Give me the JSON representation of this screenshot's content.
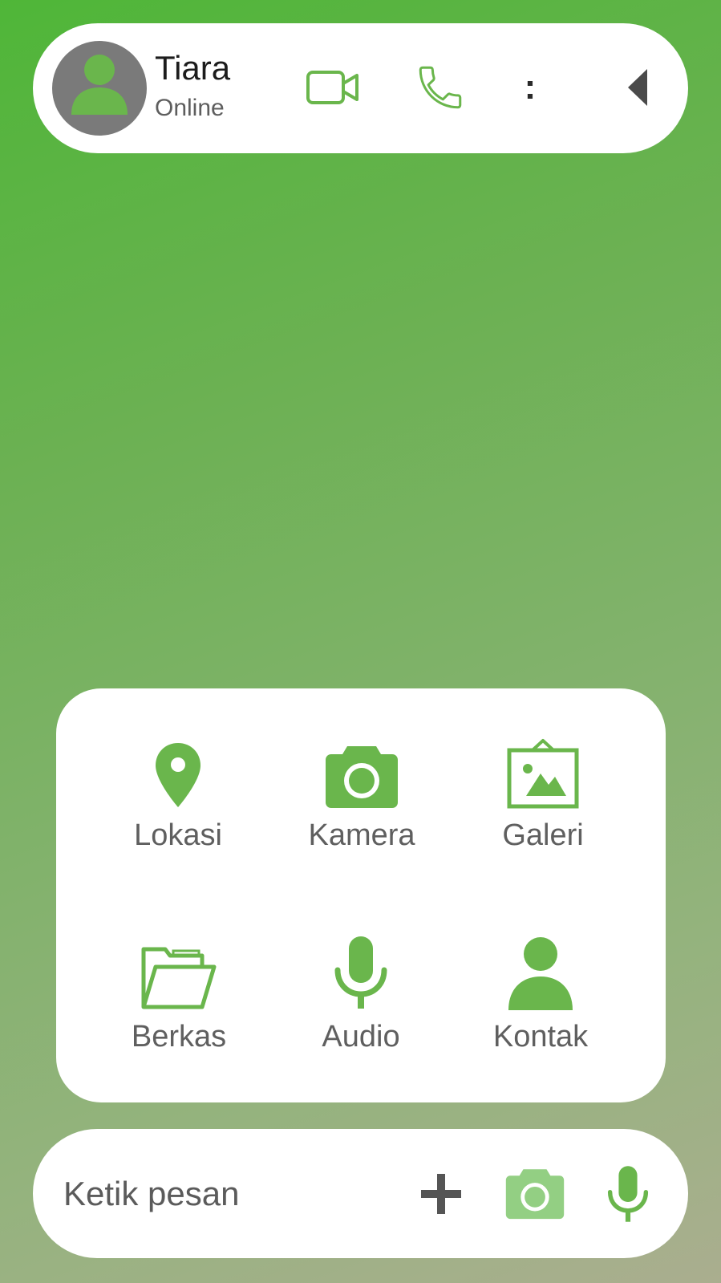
{
  "header": {
    "contact_name": "Tiara",
    "contact_status": "Online",
    "avatar_icon": "person-icon",
    "actions": [
      "video-call-icon",
      "phone-icon",
      "more-vertical-icon",
      "back-triangle-icon"
    ],
    "menu_glyph": ":"
  },
  "attachments": [
    {
      "label": "Lokasi",
      "icon": "location-pin-icon"
    },
    {
      "label": "Kamera",
      "icon": "camera-icon"
    },
    {
      "label": "Galeri",
      "icon": "gallery-icon"
    },
    {
      "label": "Berkas",
      "icon": "folder-icon"
    },
    {
      "label": "Audio",
      "icon": "microphone-icon"
    },
    {
      "label": "Kontak",
      "icon": "contact-person-icon"
    }
  ],
  "composer": {
    "placeholder": "Ketik pesan",
    "value": "",
    "icons": [
      "plus-icon",
      "camera-icon",
      "microphone-icon"
    ]
  },
  "colors": {
    "accent": "#6ab64c",
    "accent_light": "#93cf83",
    "avatar_bg": "#7a7a7a",
    "label_gray": "#5f5f5f"
  }
}
